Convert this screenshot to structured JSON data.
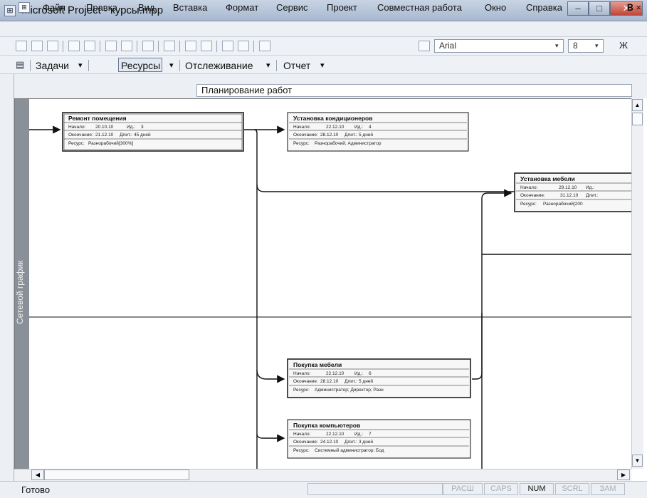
{
  "window": {
    "title": "Microsoft Project - курсы.mpp",
    "app_icon": "project-app-icon",
    "minimize_glyph": "–",
    "maximize_glyph": "□",
    "close_glyph": "✕"
  },
  "menu": {
    "icon_glyph": "⊞",
    "items": [
      "Файл",
      "Правка",
      "Вид",
      "Вставка",
      "Формат",
      "Сервис",
      "Проект",
      "Совместная работа",
      "Окно",
      "Справка"
    ],
    "right_glyphs": "𝐁 ×"
  },
  "toolbar": {
    "font": "Arial",
    "size": "8",
    "bold": "Ж"
  },
  "toolbar2": {
    "icon_glyph": "▤",
    "tasks": "Задачи",
    "resources": "Ресурсы",
    "tracking": "Отслеживание",
    "report": "Отчет",
    "dropdown_arrow": "▾"
  },
  "entry": {
    "value": "Планирование работ"
  },
  "view": {
    "side_label": "Сетевой график"
  },
  "nodes": [
    {
      "name": "Ремонт помещения",
      "start_label": "Начало:",
      "start": "20.10.10",
      "id_label": "Ид.:",
      "id": "3",
      "finish_label": "Окончание:",
      "finish": "21.12.10",
      "dur_label": "Длит.:",
      "dur": "45 дней",
      "res_label": "Ресурс:",
      "resources": "Разнорабочий[300%]"
    },
    {
      "name": "Установка кондиционеров",
      "start_label": "Начало:",
      "start": "22.12.10",
      "id_label": "Ид.:",
      "id": "4",
      "finish_label": "Окончание:",
      "finish": "28.12.10",
      "dur_label": "Длит.:",
      "dur": "5 дней",
      "res_label": "Ресурс:",
      "resources": "Разнорабочий; Администратор"
    },
    {
      "name": "Установка мебели",
      "start_label": "Начало:",
      "start": "29.12.10",
      "id_label": "Ид.:",
      "id": "",
      "finish_label": "Окончание:",
      "finish": "31.12.10",
      "dur_label": "Длит.:",
      "dur": "",
      "res_label": "Ресурс:",
      "resources": "Разнорабочий[200"
    },
    {
      "name": "Покупка мебели",
      "start_label": "Начало:",
      "start": "22.12.10",
      "id_label": "Ид.:",
      "id": "6",
      "finish_label": "Окончание:",
      "finish": "28.12.10",
      "dur_label": "Длит.:",
      "dur": "5 дней",
      "res_label": "Ресурс:",
      "resources": "Администратор; Директор; Разн"
    },
    {
      "name": "Покупка компьютеров",
      "start_label": "Начало:",
      "start": "22.12.10",
      "id_label": "Ид.:",
      "id": "7",
      "finish_label": "Окончание:",
      "finish": "24.12.10",
      "dur_label": "Длит.:",
      "dur": "3 дней",
      "res_label": "Ресурс:",
      "resources": "Системный администратор; Бод"
    }
  ],
  "scroll": {
    "up": "▲",
    "down": "▼",
    "left": "◀",
    "right": "▶"
  },
  "status": {
    "text": "Готово",
    "indicators": [
      "РАСШ",
      "CAPS",
      "NUM",
      "SCRL",
      "ЗАМ"
    ],
    "active": [
      "NUM"
    ]
  },
  "colors": {
    "node_border": "#111111",
    "node_fill": "#f7f7f7",
    "side_bar": "#8a9098"
  }
}
